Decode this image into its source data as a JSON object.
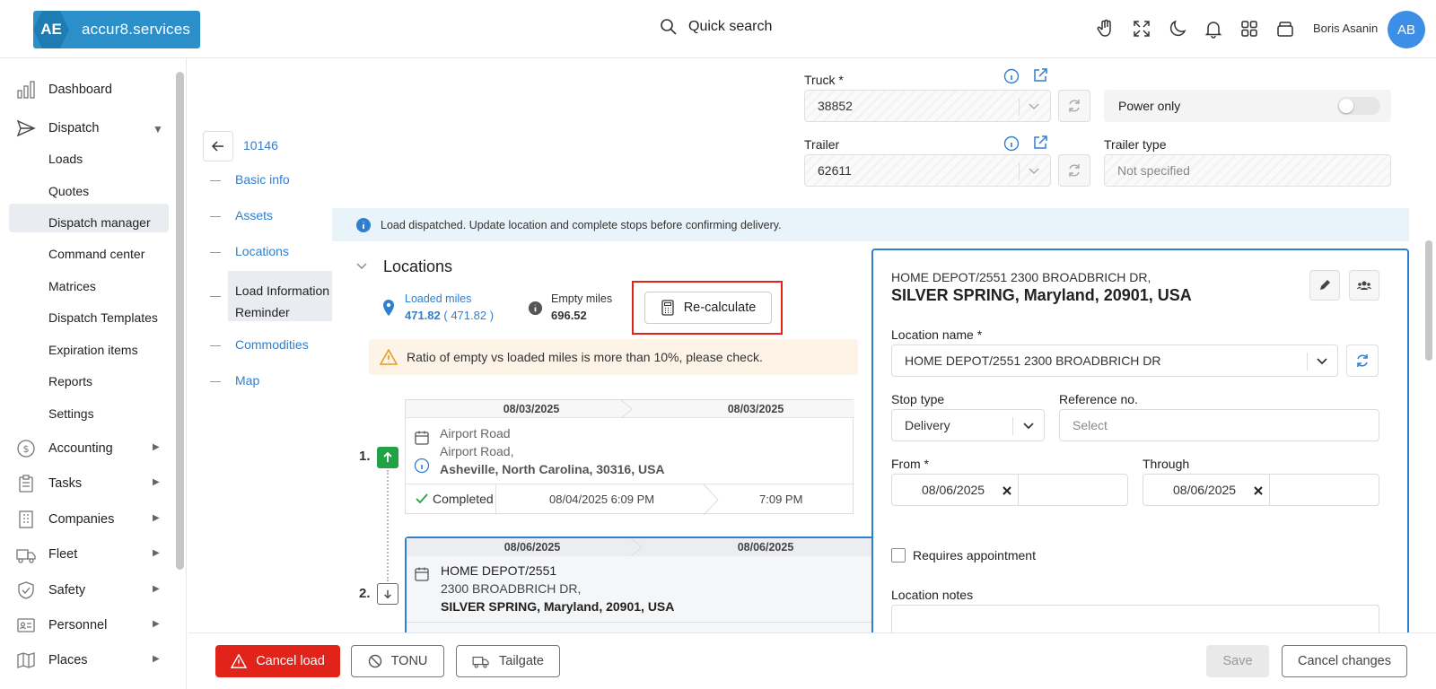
{
  "header": {
    "logo_mark": "AE",
    "logo_text": "accur8.services",
    "search_label": "Quick search",
    "user_name": "Boris Asanin",
    "avatar_initials": "AB"
  },
  "sidebar": {
    "dashboard": "Dashboard",
    "dispatch": "Dispatch",
    "sub": [
      "Loads",
      "Quotes",
      "Dispatch manager",
      "Command center",
      "Matrices",
      "Dispatch Templates",
      "Expiration items",
      "Reports",
      "Settings"
    ],
    "accounting": "Accounting",
    "tasks": "Tasks",
    "companies": "Companies",
    "fleet": "Fleet",
    "safety": "Safety",
    "personnel": "Personnel",
    "places": "Places"
  },
  "section_nav": {
    "load_id": "10146",
    "items": [
      "Basic info",
      "Assets",
      "Locations",
      "Load Information",
      "Reminder",
      "Commodities",
      "Map"
    ]
  },
  "assets": {
    "truck_label": "Truck *",
    "truck_value": "38852",
    "power_only_label": "Power only",
    "trailer_label": "Trailer",
    "trailer_value": "62611",
    "trailer_type_label": "Trailer type",
    "trailer_type_placeholder": "Not specified"
  },
  "banner": "Load dispatched. Update location and complete stops before confirming delivery.",
  "locations": {
    "title": "Locations",
    "loaded_miles_label": "Loaded miles",
    "loaded_miles_value": "471.82",
    "loaded_miles_paren": "( 471.82 )",
    "empty_miles_label": "Empty miles",
    "empty_miles_value": "696.52",
    "recalc_label": "Re-calculate",
    "warning": "Ratio of empty vs loaded miles is more than 10%, please check."
  },
  "stops": [
    {
      "num": "1.",
      "date_from": "08/03/2025",
      "date_to": "08/03/2025",
      "name": "Airport Road",
      "street": "Airport Road,",
      "city": "Asheville, North Carolina, 30316, USA",
      "status": "Completed",
      "completed_at": "08/04/2025 6:09 PM",
      "completed_end": "7:09 PM"
    },
    {
      "num": "2.",
      "date_from": "08/06/2025",
      "date_to": "08/06/2025",
      "name": "HOME DEPOT/2551",
      "street": "2300 BROADBRICH DR,",
      "city": "SILVER SPRING, Maryland, 20901, USA"
    }
  ],
  "detail": {
    "addr_line1": "HOME DEPOT/2551 2300 BROADBRICH DR,",
    "addr_line2": "SILVER SPRING, Maryland, 20901, USA",
    "location_name_label": "Location name *",
    "location_name_value": "HOME DEPOT/2551 2300 BROADBRICH DR",
    "stop_type_label": "Stop type",
    "stop_type_value": "Delivery",
    "reference_label": "Reference no.",
    "reference_placeholder": "Select",
    "from_label": "From *",
    "from_value": "08/06/2025",
    "through_label": "Through",
    "through_value": "08/06/2025",
    "requires_appt": "Requires appointment",
    "location_notes": "Location notes"
  },
  "footer": {
    "cancel_load": "Cancel load",
    "tonu": "TONU",
    "tailgate": "Tailgate",
    "save": "Save",
    "cancel_changes": "Cancel changes"
  },
  "colors": {
    "primary": "#2f7fd1",
    "danger": "#e2231a",
    "success": "#22a244",
    "logo_bg": "#2b8fc9"
  }
}
